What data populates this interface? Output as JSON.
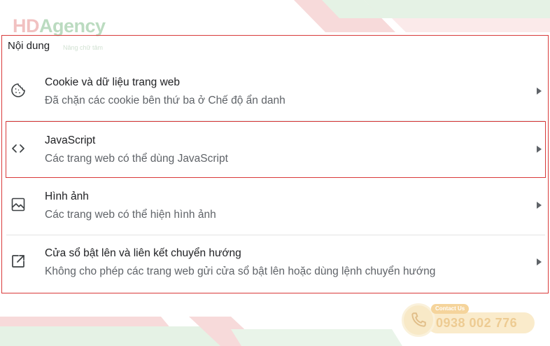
{
  "watermark": {
    "logo_hd": "HD",
    "logo_agency": "Agency",
    "slogan": "Nâng chữ tâm"
  },
  "section": {
    "title": "Nội dung"
  },
  "items": [
    {
      "icon": "cookie-icon",
      "title": "Cookie và dữ liệu trang web",
      "subtitle": "Đã chặn các cookie bên thứ ba ở Chế độ ẩn danh"
    },
    {
      "icon": "code-icon",
      "title": "JavaScript",
      "subtitle": "Các trang web có thể dùng JavaScript"
    },
    {
      "icon": "image-icon",
      "title": "Hình ảnh",
      "subtitle": "Các trang web có thể hiện hình ảnh"
    },
    {
      "icon": "open-in-new-icon",
      "title": "Cửa sổ bật lên và liên kết chuyển hướng",
      "subtitle": "Không cho phép các trang web gửi cửa sổ bật lên hoặc dùng lệnh chuyển hướng"
    }
  ],
  "contact": {
    "tag": "Contact Us",
    "phone": "0938 002 776"
  },
  "colors": {
    "highlight_border": "#d93a3a",
    "stripe_pink": "#f6dcdc",
    "stripe_green": "#e3f1e3",
    "text_primary": "#202124",
    "text_secondary": "#5f6368"
  }
}
